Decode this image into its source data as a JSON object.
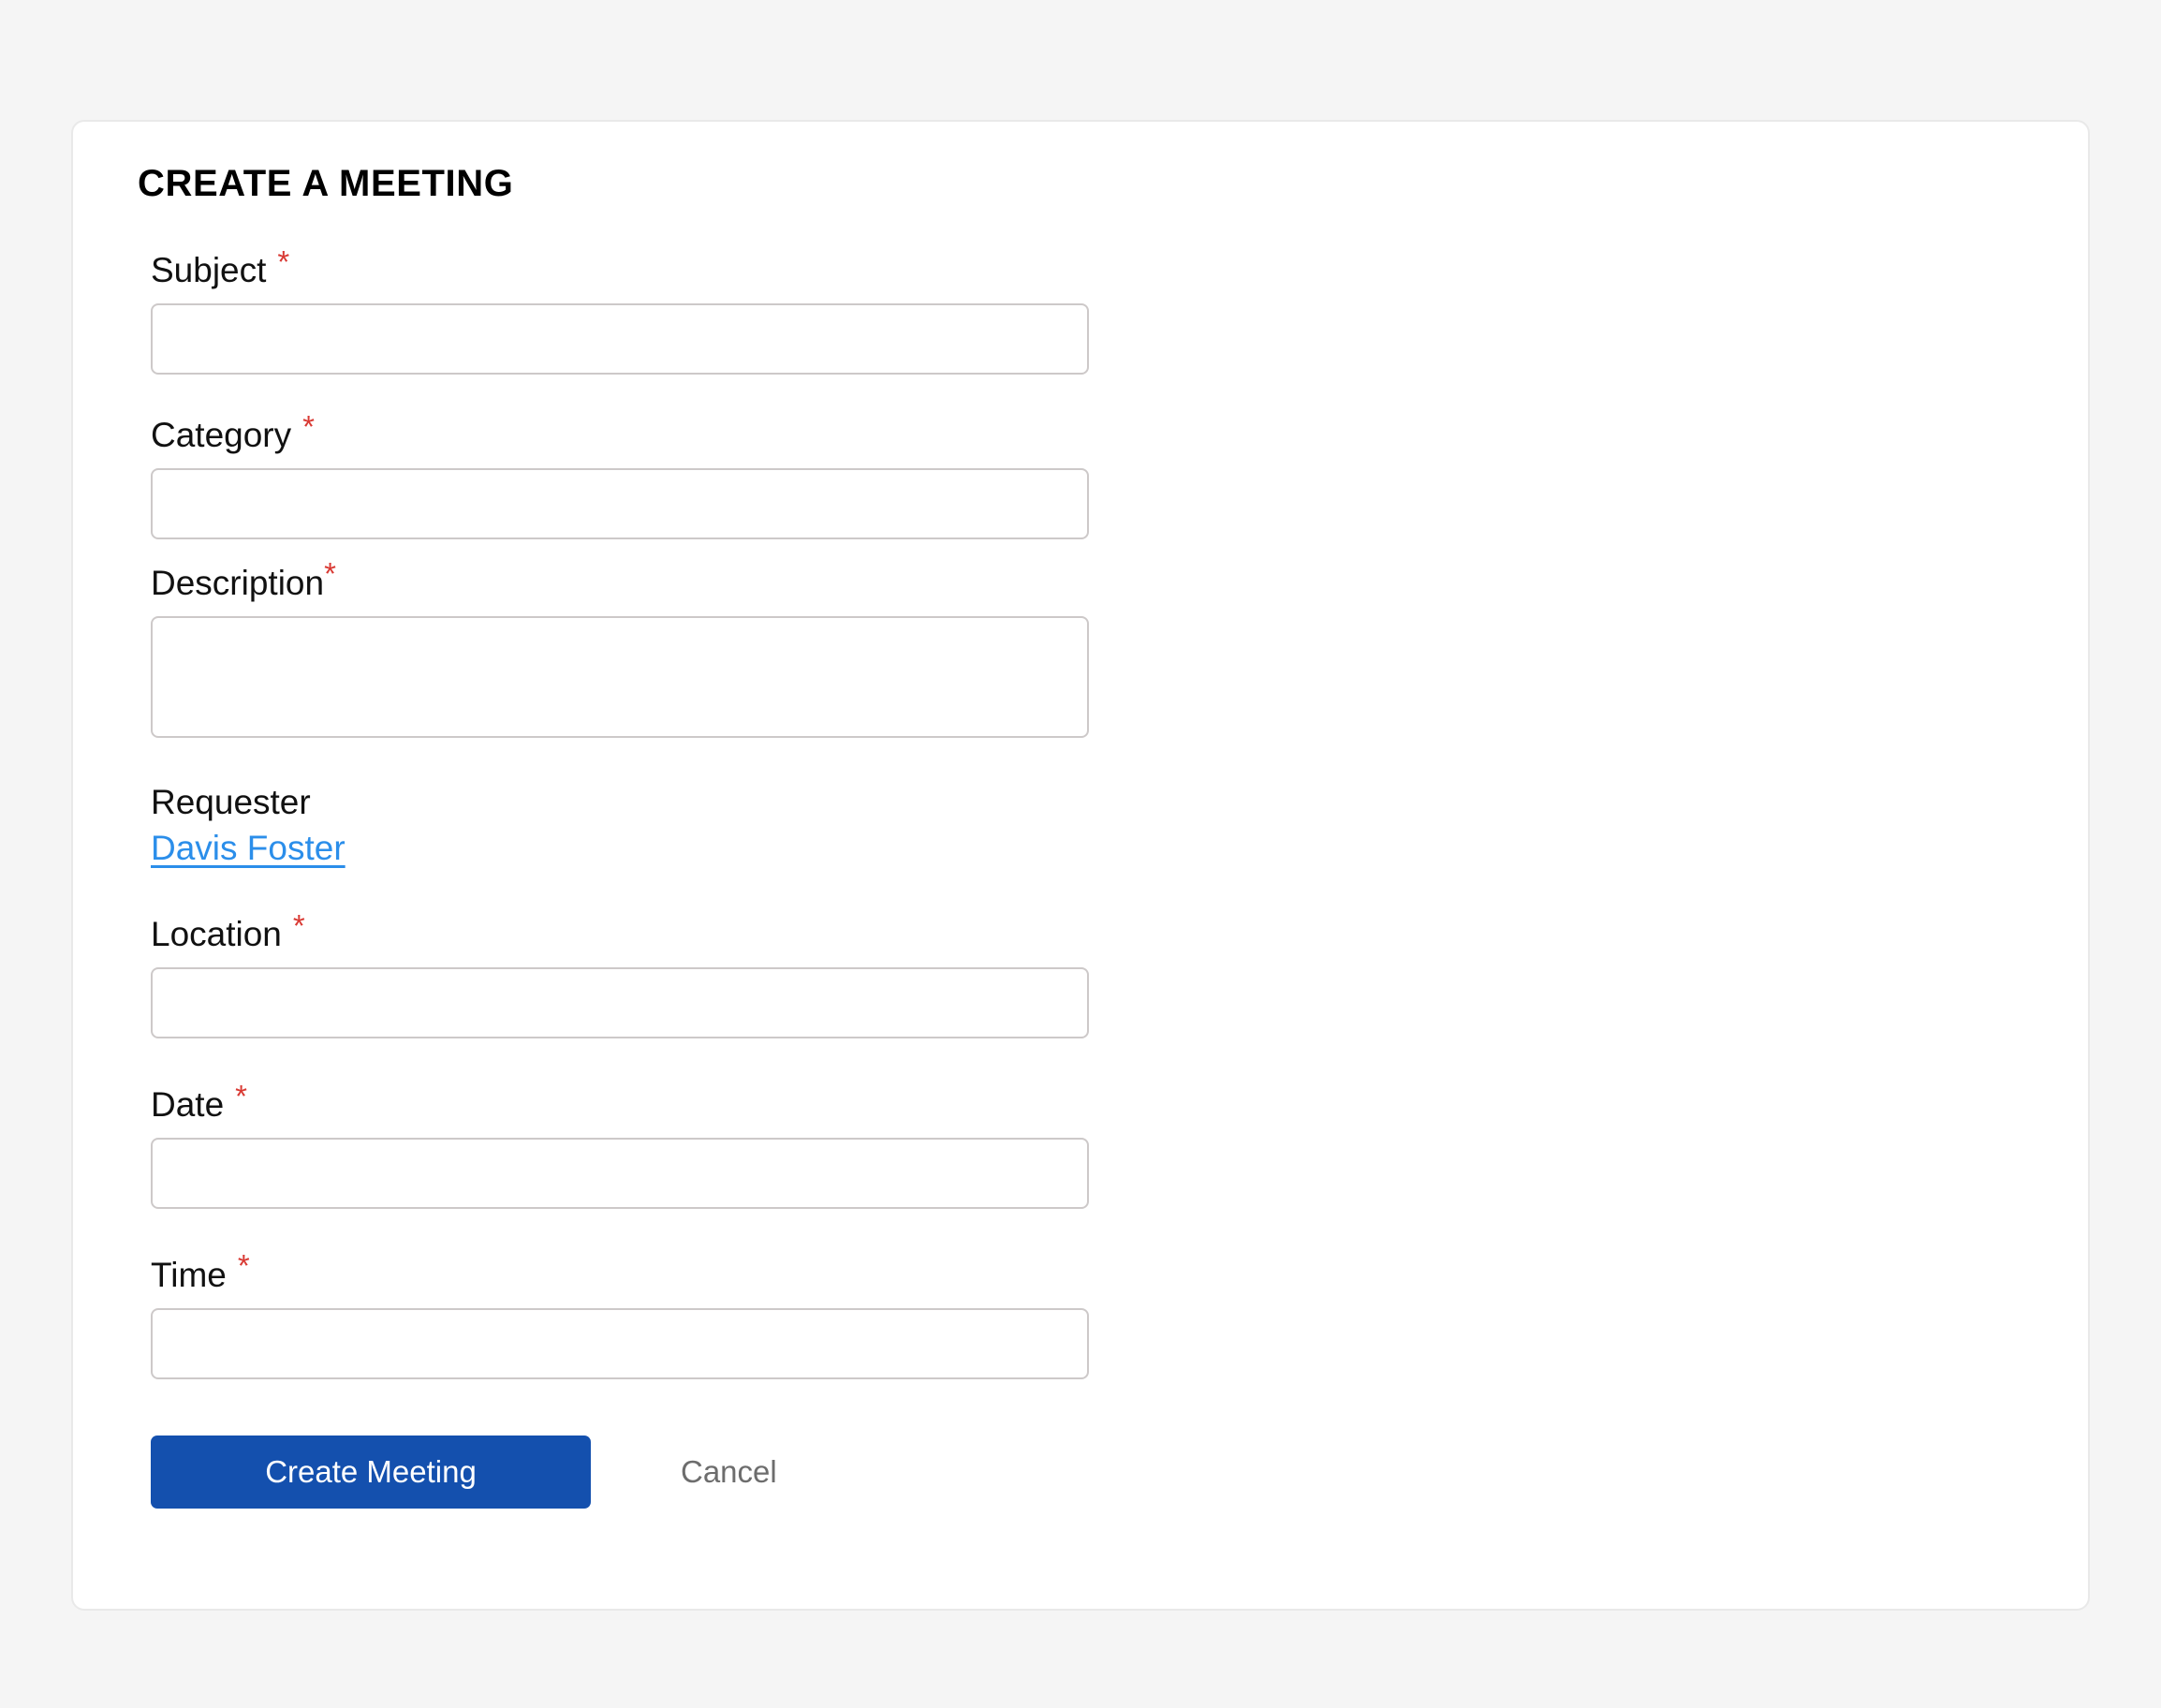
{
  "page": {
    "background_color": "#f5f5f5",
    "card_background": "#ffffff"
  },
  "form": {
    "title": "CREATE A MEETING",
    "required_marker": "*",
    "required_color": "#d93a34",
    "link_color": "#2b8eea",
    "primary_button_color": "#1450ae",
    "fields": {
      "subject": {
        "label": "Subject",
        "required": true,
        "value": "",
        "placeholder": ""
      },
      "category": {
        "label": "Category",
        "required": true,
        "value": "",
        "placeholder": ""
      },
      "description": {
        "label": "Description",
        "required": true,
        "value": "",
        "placeholder": ""
      },
      "requester": {
        "label": "Requester",
        "required": false,
        "value": "Davis Foster"
      },
      "location": {
        "label": "Location",
        "required": true,
        "value": "",
        "placeholder": ""
      },
      "date": {
        "label": "Date",
        "required": true,
        "value": "",
        "placeholder": ""
      },
      "time": {
        "label": "Time",
        "required": true,
        "value": "",
        "placeholder": ""
      }
    },
    "actions": {
      "submit_label": "Create Meeting",
      "cancel_label": "Cancel"
    }
  }
}
